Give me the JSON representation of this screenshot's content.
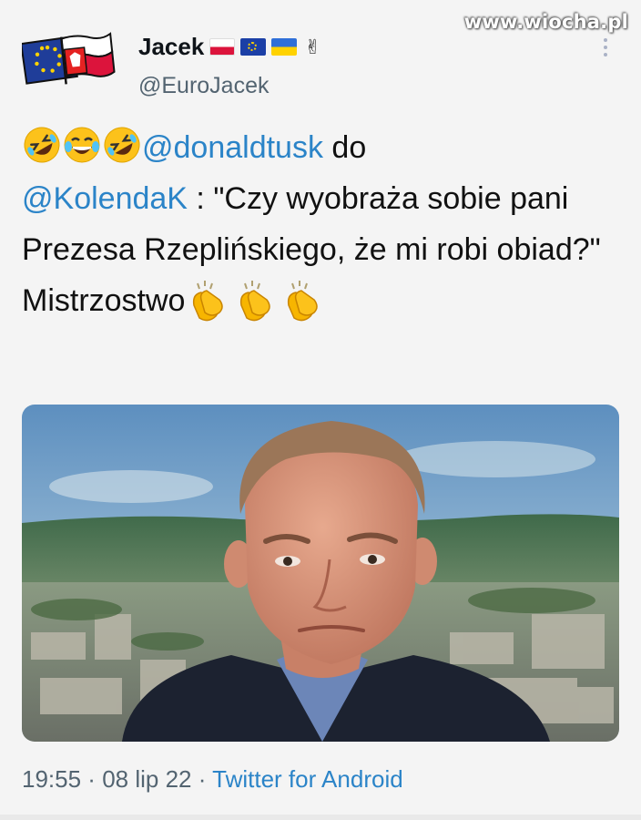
{
  "watermark": "www.wiocha.pl",
  "author": {
    "display_name": "Jacek",
    "handle": "@EuroJacek",
    "name_badges": [
      "flag-poland",
      "flag-eu",
      "flag-ukraine",
      "victory-hand"
    ]
  },
  "tweet": {
    "emojis_lead": [
      "rolling-on-floor-laughing",
      "face-with-tears-of-joy",
      "rolling-on-floor-laughing"
    ],
    "mention_1": "@donaldtusk",
    "word_do": " do",
    "mention_2": "@KolendaK",
    "quote": " : \"Czy wyobraża sobie pani Prezesa Rzeplińskiego, że mi robi obiad?\"",
    "closing": "Mistrzostwo",
    "emojis_trail": [
      "clapping-hands",
      "clapping-hands",
      "clapping-hands"
    ]
  },
  "meta": {
    "time": "19:55",
    "sep1": " · ",
    "date": "08 lip 22",
    "sep2": " · ",
    "source": "Twitter for Android"
  },
  "colors": {
    "link": "#2b84c8",
    "secondary": "#536471",
    "background": "#f4f4f4"
  }
}
